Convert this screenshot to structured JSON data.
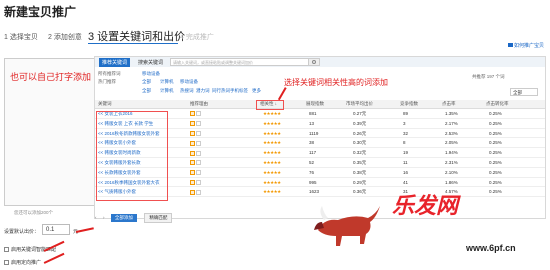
{
  "page_title": "新建宝贝推广",
  "steps": [
    {
      "label": "1 选择宝贝",
      "state": "done"
    },
    {
      "label": "2 添加创意",
      "state": "done"
    },
    {
      "label": "3 设置关键词和出价",
      "state": "active"
    },
    {
      "label": "4 完成推广",
      "state": "disabled"
    }
  ],
  "help_link": "如何推广宝贝",
  "left": {
    "annotation": "也可以自己打字添加",
    "count_text": "您还可以添加200个",
    "bid_label": "设置默认出价：",
    "bid_value": "0.1",
    "bid_unit": "元",
    "checkboxes": [
      {
        "label": "启用关键词智能匹配",
        "checked": true
      },
      {
        "label": "启用定向推广",
        "checked": true
      }
    ]
  },
  "panel": {
    "tabs": [
      "推荐关键词",
      "搜索关键词"
    ],
    "search_placeholder": "请输入关键词，或直接粘贴或调整关键词加价",
    "filters": [
      {
        "label": "所有推荐词",
        "options": [
          "移动设备"
        ]
      },
      {
        "label": "热门推荐",
        "options": [
          "全部",
          "计算机",
          "移动设备"
        ]
      },
      {
        "label": "",
        "options": [
          "全部",
          "计算机",
          "热搜词",
          "潜力词",
          "同行热词",
          "手机标签",
          "更多"
        ]
      }
    ],
    "toolbar_right_text": "共推荐 197 个词",
    "sort_select_label": "全部",
    "headers": [
      "关键词",
      "推荐理由",
      "相关性 ↓",
      "展现指数",
      "市场平均出价",
      "竞争指数",
      "点击率",
      "点击转化率"
    ],
    "rows": [
      {
        "kw": "女装上衣2016",
        "stars": "★★★★★",
        "imp": "881",
        "bid": "0.27元",
        "comp": "89",
        "ctr": "1.35%",
        "cvr": "0.25%"
      },
      {
        "kw": "韩版女装 上衣 长款 学生",
        "stars": "★★★★★",
        "imp": "13",
        "bid": "0.39元",
        "comp": "3",
        "ctr": "2.17%",
        "cvr": "0.25%"
      },
      {
        "kw": "2016秋冬新款韩版女装外套",
        "stars": "★★★★★",
        "imp": "1119",
        "bid": "0.26元",
        "comp": "32",
        "ctr": "2.53%",
        "cvr": "0.25%"
      },
      {
        "kw": "韩版女装小外套",
        "stars": "★★★★★",
        "imp": "38",
        "bid": "0.30元",
        "comp": "8",
        "ctr": "2.05%",
        "cvr": "0.25%"
      },
      {
        "kw": "韩版女装时尚新款",
        "stars": "★★★★★",
        "imp": "117",
        "bid": "0.32元",
        "comp": "19",
        "ctr": "1.94%",
        "cvr": "0.25%"
      },
      {
        "kw": "女装韩版外套长款",
        "stars": "★★★★★",
        "imp": "52",
        "bid": "0.35元",
        "comp": "11",
        "ctr": "2.31%",
        "cvr": "0.25%"
      },
      {
        "kw": "长款韩版女装外套",
        "stars": "★★★★★",
        "imp": "76",
        "bid": "0.38元",
        "comp": "16",
        "ctr": "2.10%",
        "cvr": "0.25%"
      },
      {
        "kw": "2016秋季韩国女装外套大衣",
        "stars": "★★★★★",
        "imp": "995",
        "bid": "0.29元",
        "comp": "41",
        "ctr": "1.86%",
        "cvr": "0.25%"
      },
      {
        "kw": "气质韩版小外套",
        "stars": "★★★★★",
        "imp": "1623",
        "bid": "0.36元",
        "comp": "31",
        "ctr": "4.57%",
        "cvr": "0.25%"
      }
    ],
    "annotation": "选择关键词相关性高的词添加",
    "bottom_buttons": [
      "全部添加",
      "精确匹配"
    ]
  },
  "watermark": {
    "text": "乐发网",
    "url": "www.6pf.cn"
  },
  "colors": {
    "accent": "#1f6fc8",
    "annotation": "#e02020",
    "star": "#f39800"
  }
}
